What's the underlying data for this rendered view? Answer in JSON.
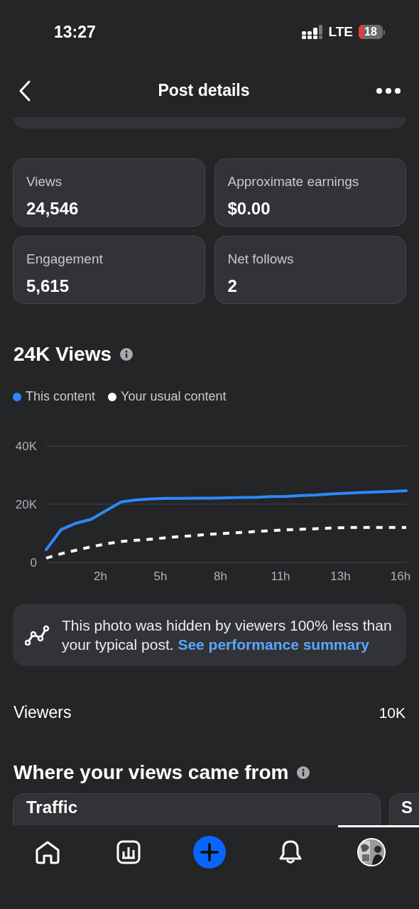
{
  "status_bar": {
    "time": "13:27",
    "network": "LTE",
    "battery": "18"
  },
  "header": {
    "title": "Post details"
  },
  "stats": [
    {
      "label": "Views",
      "value": "24,546"
    },
    {
      "label": "Approximate earnings",
      "value": "$0.00"
    },
    {
      "label": "Engagement",
      "value": "5,615"
    },
    {
      "label": "Net follows",
      "value": "2"
    }
  ],
  "views_section": {
    "title": "24K Views",
    "chart_data": {
      "type": "line",
      "ylim": [
        0,
        40000
      ],
      "categories": [
        null,
        null,
        null,
        null,
        "2h",
        null,
        null,
        null,
        "5h",
        null,
        null,
        null,
        "8h",
        null,
        null,
        null,
        "11h",
        null,
        null,
        null,
        "13h",
        null,
        null,
        null,
        "16h"
      ],
      "yticks": [
        {
          "value": 0,
          "label": "0"
        },
        {
          "value": 20000,
          "label": "20K"
        },
        {
          "value": 40000,
          "label": "40K"
        }
      ],
      "series": [
        {
          "name": "This content",
          "color": "#2d88ff",
          "line_style": "solid",
          "values": [
            4400,
            11300,
            13500,
            14800,
            17800,
            20800,
            21500,
            21800,
            22000,
            22000,
            22100,
            22100,
            22200,
            22300,
            22400,
            22600,
            22700,
            23000,
            23200,
            23500,
            23800,
            24000,
            24200,
            24400,
            24600
          ]
        },
        {
          "name": "Your usual content",
          "color": "#ffffff",
          "line_style": "dashed",
          "values": [
            1500,
            3000,
            4200,
            5400,
            6400,
            7200,
            7600,
            8000,
            8500,
            8900,
            9300,
            9700,
            10000,
            10300,
            10600,
            10900,
            11200,
            11400,
            11600,
            11800,
            12000,
            12000,
            12000,
            12000,
            12000
          ]
        }
      ]
    }
  },
  "insight": {
    "text": "This photo was hidden by viewers 100% less than your typical post.",
    "link": "See performance summary"
  },
  "viewers": {
    "label": "Viewers",
    "value": "10K"
  },
  "sources": {
    "title": "Where your views came from",
    "cards": [
      "Traffic",
      "S"
    ]
  },
  "nav": [
    {
      "kind": "home"
    },
    {
      "kind": "insights"
    },
    {
      "kind": "create"
    },
    {
      "kind": "notifications"
    },
    {
      "kind": "profile"
    }
  ]
}
